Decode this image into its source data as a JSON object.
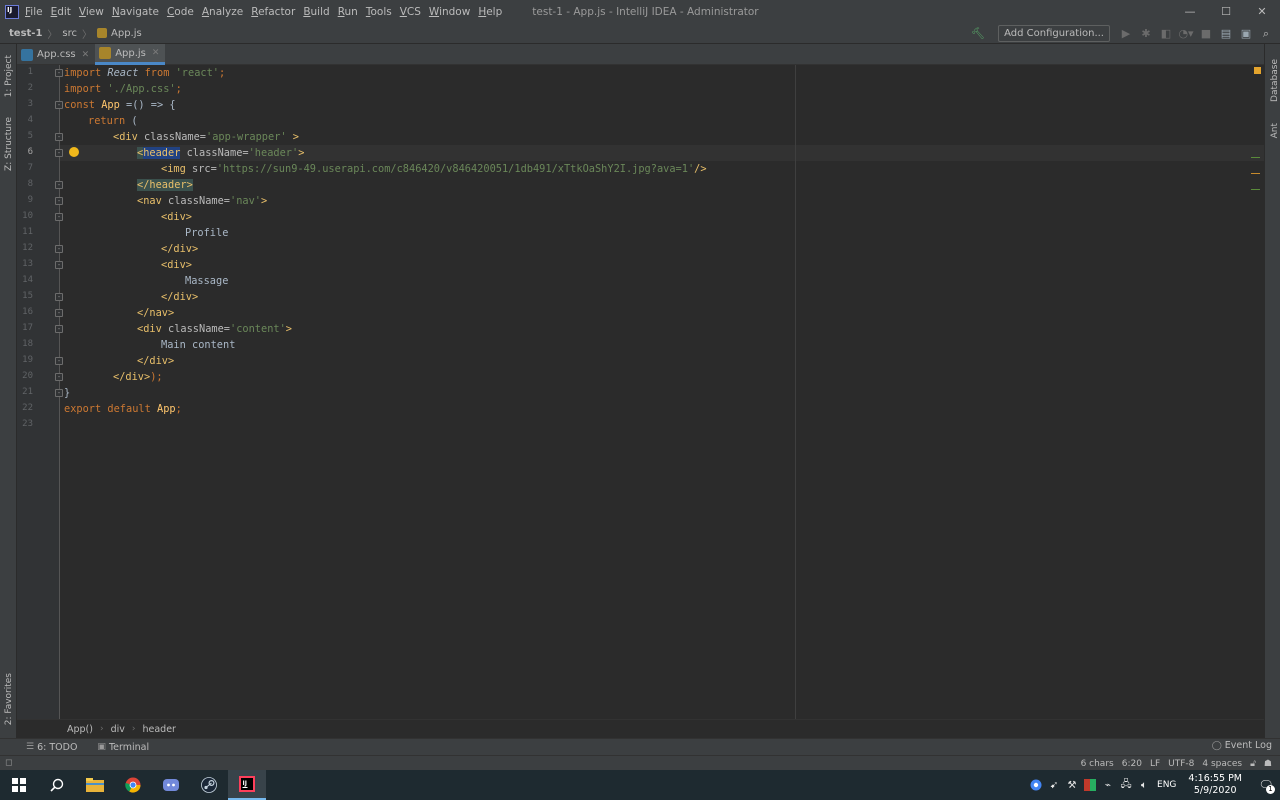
{
  "menu": {
    "items": [
      "File",
      "Edit",
      "View",
      "Navigate",
      "Code",
      "Analyze",
      "Refactor",
      "Build",
      "Run",
      "Tools",
      "VCS",
      "Window",
      "Help"
    ],
    "window_title": "test-1 - App.js - IntelliJ IDEA - Administrator"
  },
  "window_controls": {
    "minimize": "—",
    "maximize": "☐",
    "close": "✕"
  },
  "navbar": {
    "crumbs": [
      "test-1",
      "src",
      "App.js"
    ],
    "add_configuration": "Add Configuration..."
  },
  "left_tabs": {
    "project": "1: Project",
    "structure": "Z: Structure",
    "favorites": "2: Favorites"
  },
  "right_tabs": {
    "database": "Database",
    "ant": "Ant"
  },
  "tabs": [
    {
      "label": "App.css",
      "icon": "css-file-icon"
    },
    {
      "label": "App.js",
      "icon": "js-file-icon",
      "active": true
    }
  ],
  "editor": {
    "line_numbers": [
      "1",
      "2",
      "3",
      "4",
      "5",
      "6",
      "7",
      "8",
      "9",
      "10",
      "11",
      "12",
      "13",
      "14",
      "15",
      "16",
      "17",
      "18",
      "19",
      "20",
      "21",
      "22",
      "23"
    ],
    "code": {
      "l1_import": "import ",
      "l1_react": "React",
      "l1_from": " from ",
      "l1_str": "'react'",
      "l1_semi": ";",
      "l2_import": "import ",
      "l2_str": "'./App.css'",
      "l2_semi": ";",
      "l3_const": "const ",
      "l3_app": "App",
      "l3_rest": " =() => {",
      "l4_return": "return",
      "l4_rest": " (",
      "l5_open": "<div ",
      "l5_attr": "className=",
      "l5_str": "'app-wrapper'",
      "l5_close": " >",
      "l6_lt": "<",
      "l6_tag": "header",
      "l6_attr": " className=",
      "l6_str": "'header'",
      "l6_close": ">",
      "l7_open": "<img ",
      "l7_attr": "src=",
      "l7_str": "'https://sun9-49.userapi.com/c846420/v846420051/1db491/xTtkOaShY2I.jpg?ava=1'",
      "l7_close": "/>",
      "l8_close": "</header>",
      "l9_open": "<nav ",
      "l9_attr": "className=",
      "l9_str": "'nav'",
      "l9_close": ">",
      "l10": "<div>",
      "l11": "Profile",
      "l12": "</div>",
      "l13": "<div>",
      "l14": "Massage",
      "l15": "</div>",
      "l16": "</nav>",
      "l17_open": "<div ",
      "l17_attr": "className=",
      "l17_str": "'content'",
      "l17_close": ">",
      "l18": "Main content",
      "l19": "</div>",
      "l20_tag": "</div>",
      "l20_rest": ");",
      "l21": "}",
      "l22_export": "export default ",
      "l22_app": "App",
      "l22_semi": ";"
    }
  },
  "editor_breadcrumbs": [
    "App()",
    "div",
    "header"
  ],
  "tool_windows": {
    "todo": "6: TODO",
    "terminal": "Terminal",
    "event_log": "Event Log"
  },
  "status": {
    "chars": "6 chars",
    "position": "6:20",
    "line_sep": "LF",
    "encoding": "UTF-8",
    "indent": "4 spaces"
  },
  "taskbar": {
    "apps": [
      "windows-start-icon",
      "search-icon",
      "file-explorer-icon",
      "chrome-icon",
      "discord-icon",
      "steam-icon",
      "intellij-icon"
    ],
    "lang": "ENG",
    "time": "4:16:55 PM",
    "date": "5/9/2020",
    "notification_count": "1"
  },
  "colors": {
    "editor_bg": "#2b2b2b",
    "gutter_bg": "#313335",
    "chrome_bg": "#3c3f41",
    "keyword": "#cc7832",
    "string": "#6a8759",
    "tag": "#e8bf6a",
    "accent": "#4a88c7"
  }
}
